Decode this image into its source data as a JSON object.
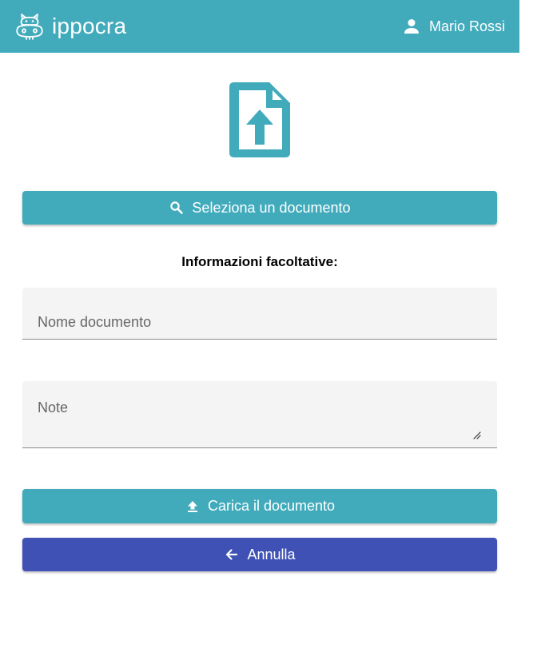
{
  "header": {
    "app_name": "ippocra",
    "logo_icon": "hippo-icon",
    "user_icon": "person-icon",
    "user_name": "Mario Rossi",
    "background_color": "#41abbc"
  },
  "main": {
    "illustration_icon": "file-upload-icon",
    "select_button": {
      "icon": "search-icon",
      "label": "Seleziona un documento"
    },
    "optional_info_title": "Informazioni facoltative:",
    "document_name_field": {
      "placeholder": "Nome documento",
      "value": ""
    },
    "notes_field": {
      "placeholder": "Note",
      "value": ""
    },
    "upload_button": {
      "icon": "upload-icon",
      "label": "Carica il documento",
      "color": "#41abbc"
    },
    "cancel_button": {
      "icon": "arrow-back-icon",
      "label": "Annulla",
      "color": "#3f51b5"
    }
  }
}
